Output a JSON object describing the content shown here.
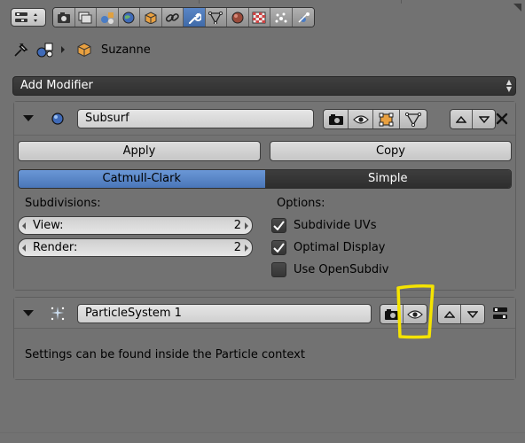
{
  "header": {
    "tabs": [
      {
        "icon": "render-icon",
        "active": false
      },
      {
        "icon": "render-layers-icon",
        "active": false
      },
      {
        "icon": "scene-icon",
        "active": false
      },
      {
        "icon": "world-icon",
        "active": false
      },
      {
        "icon": "object-icon",
        "active": false
      },
      {
        "icon": "constraints-icon",
        "active": false
      },
      {
        "icon": "modifiers-wrench-icon",
        "active": true
      },
      {
        "icon": "object-data-icon",
        "active": false
      },
      {
        "icon": "material-icon",
        "active": false
      },
      {
        "icon": "texture-icon",
        "active": false
      },
      {
        "icon": "particles-icon",
        "active": false
      },
      {
        "icon": "physics-icon",
        "active": false
      }
    ]
  },
  "context": {
    "object_name": "Suzanne"
  },
  "add_modifier": {
    "label": "Add Modifier"
  },
  "subsurf": {
    "name": "Subsurf",
    "apply_label": "Apply",
    "copy_label": "Copy",
    "type_options": [
      "Catmull-Clark",
      "Simple"
    ],
    "selected_type": "Catmull-Clark",
    "subdivisions_label": "Subdivisions:",
    "view_label": "View:",
    "view_value": "2",
    "render_label": "Render:",
    "render_value": "2",
    "options_label": "Options:",
    "options": [
      {
        "label": "Subdivide UVs",
        "checked": true
      },
      {
        "label": "Optimal Display",
        "checked": true
      },
      {
        "label": "Use OpenSubdiv",
        "checked": false
      }
    ]
  },
  "particles": {
    "name": "ParticleSystem 1",
    "info": "Settings can be found inside the Particle context"
  },
  "colors": {
    "accent_blue": "#5a86c6",
    "annotation_yellow": "#f5e400",
    "background": "#727272"
  }
}
